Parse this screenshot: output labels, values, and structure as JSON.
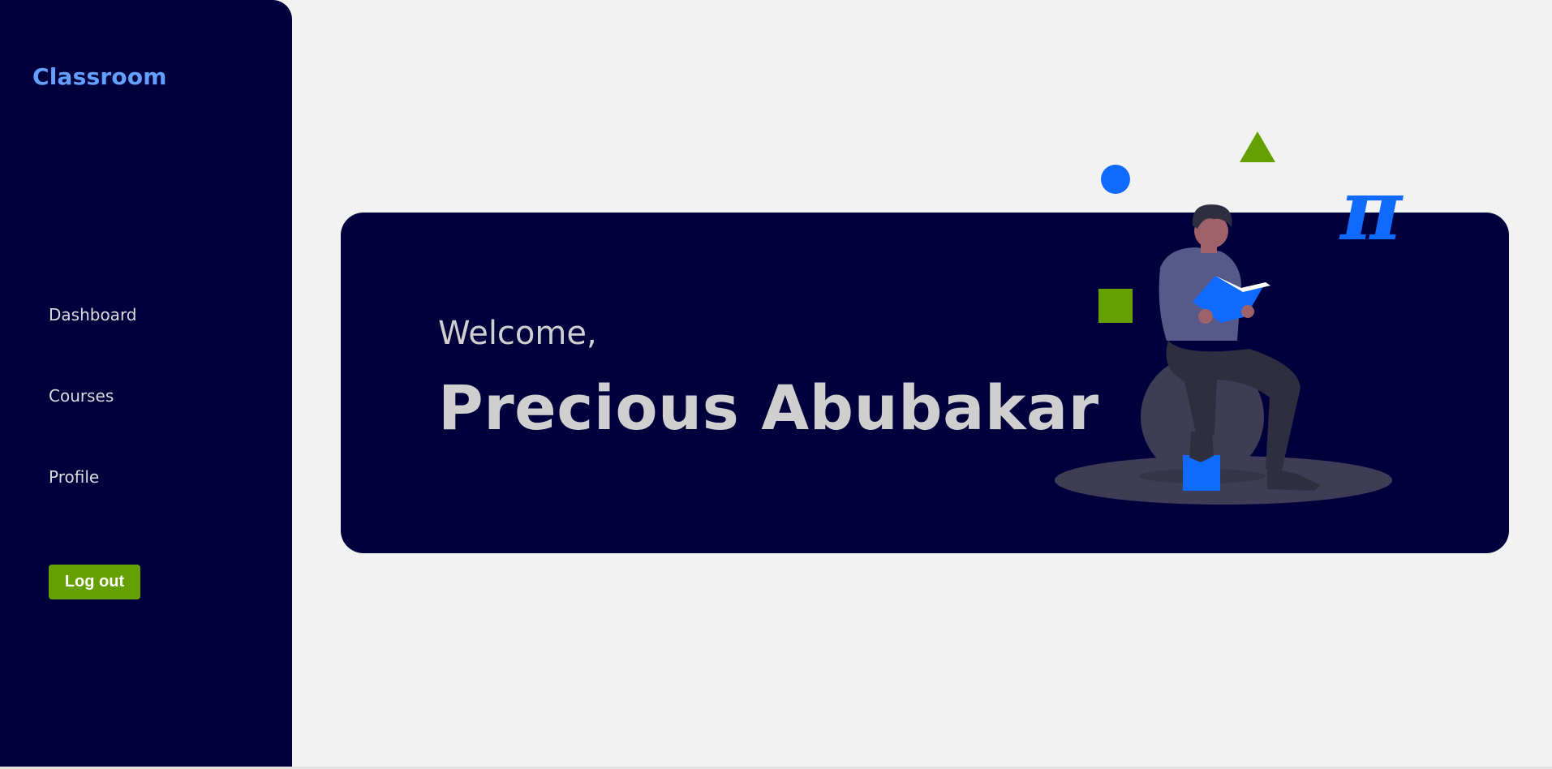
{
  "sidebar": {
    "brand": "Classroom",
    "items": [
      {
        "label": "Dashboard"
      },
      {
        "label": "Courses"
      },
      {
        "label": "Profile"
      }
    ],
    "logout_label": "Log out"
  },
  "hero": {
    "greeting": "Welcome,",
    "name": "Precious Abubakar",
    "symbol": "π"
  },
  "colors": {
    "sidebar_bg": "#01003c",
    "page_bg": "#f2f2f2",
    "brand": "#64a0ff",
    "accent_green": "#66a000",
    "accent_blue": "#0f6bff",
    "text_light": "#cfcfcf"
  },
  "icons": [
    "circle-shape",
    "triangle-shape",
    "square-shape",
    "pi-symbol",
    "reading-person-illustration"
  ]
}
